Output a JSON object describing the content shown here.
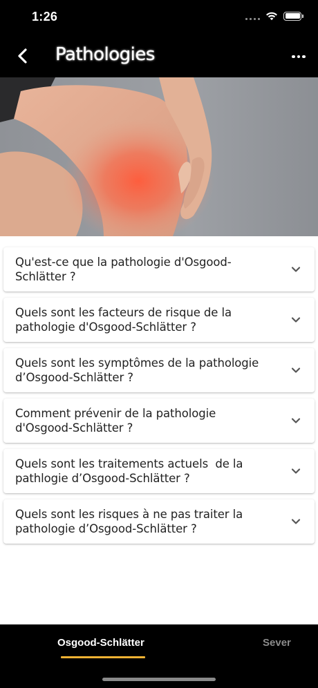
{
  "status_bar": {
    "time": "1:26",
    "icons": [
      "signal-icon",
      "wifi-icon",
      "battery-icon"
    ]
  },
  "nav": {
    "title": "Pathologies",
    "back_icon": "chevron-left-icon",
    "more_icon": "more-horizontal-icon"
  },
  "hero": {
    "icon": "knee-pain-photo"
  },
  "faq": [
    {
      "text": "Qu'est-ce que la pathologie d'Osgood-\nSchlätter ?"
    },
    {
      "text": "Quels sont les facteurs de risque de la\npathologie d'Osgood-Schlätter ?"
    },
    {
      "text": "Quels sont les symptômes de la pathologie\nd’Osgood-Schlätter ?"
    },
    {
      "text": "Comment prévenir de la pathologie\nd'Osgood-Schlätter ?"
    },
    {
      "text": "Quels sont les traitements actuels  de la\npathlogie d’Osgood-Schlätter ?"
    },
    {
      "text": "Quels sont les risques à ne pas traiter la\npathologie d’Osgood-Schlätter ?"
    }
  ],
  "tabs": [
    {
      "label": "Osgood-Schlätter",
      "active": true
    },
    {
      "label": "Sever",
      "active": false
    }
  ],
  "colors": {
    "background": "#000000",
    "accent": "#f1b233",
    "card": "#ffffff"
  }
}
